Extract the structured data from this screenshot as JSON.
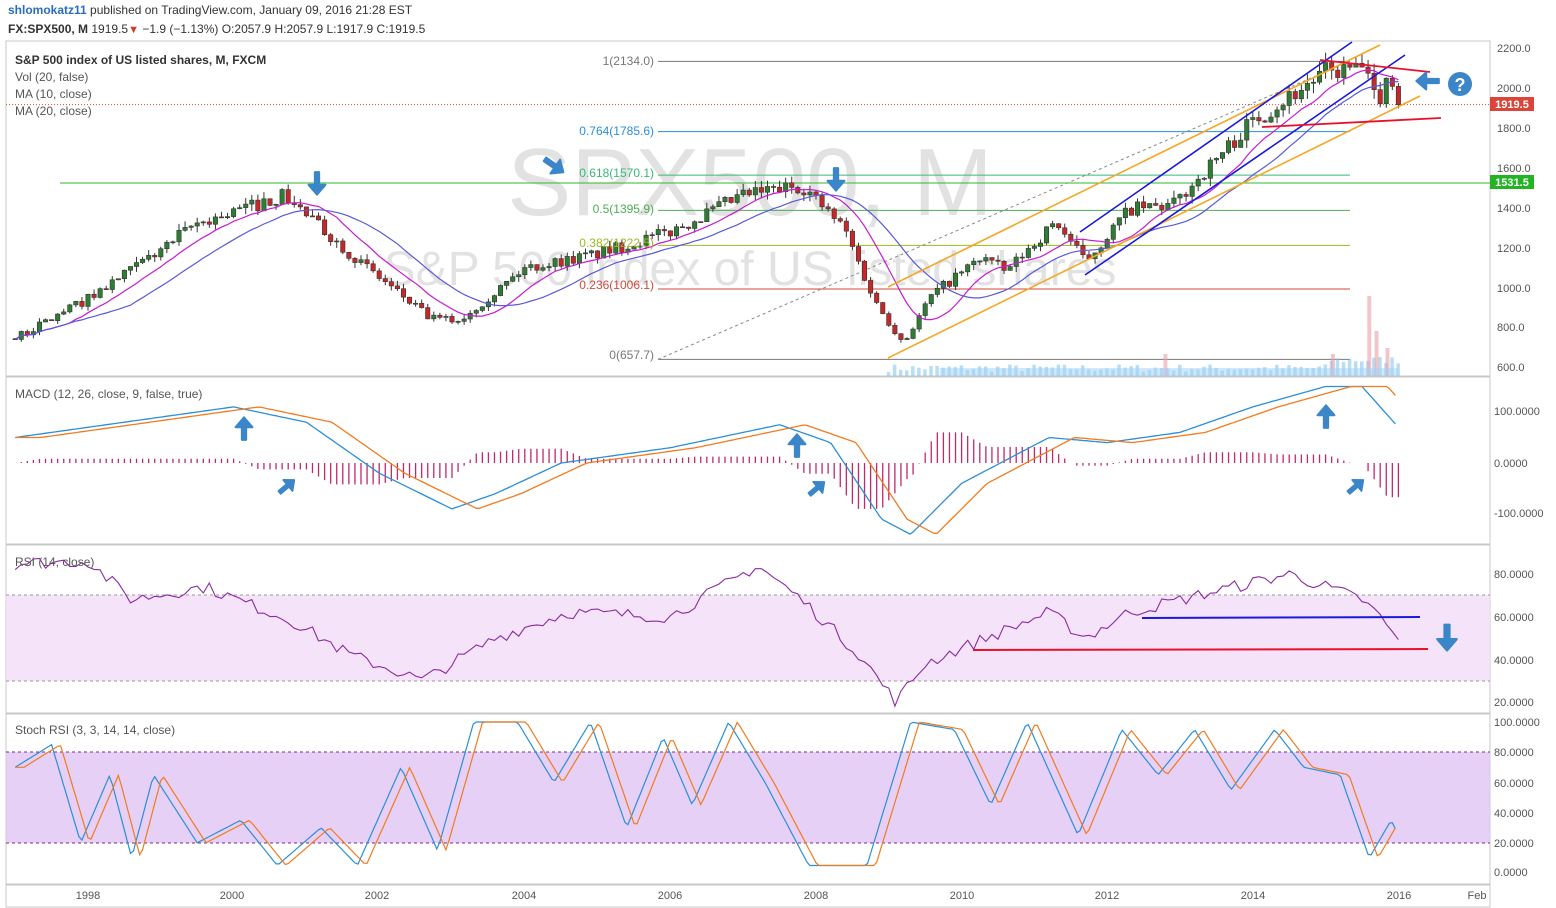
{
  "header": {
    "author": "shlomokatz11",
    "published_text": "published on TradingView.com, January 09, 2016 21:28 EST",
    "symbol": "FX:SPX500, M",
    "last": "1919.5",
    "change": "−1.9 (−1.13%)",
    "open_label": "O:",
    "open": "2057.9",
    "high_label": "H:",
    "high": "2057.9",
    "low_label": "L:",
    "low": "1917.9",
    "close_label": "C:",
    "close": "1919.5"
  },
  "main": {
    "watermark_1": "SPX500, M",
    "watermark_2": "S&P 500 index of US listed shares",
    "legend": [
      "S&P 500 index of US listed shares, M, FXCM",
      "Vol (20, false)",
      "MA (10, close)",
      "MA (20, close)"
    ],
    "y_ticks": [
      "2200.0",
      "2000.0",
      "1800.0",
      "1600.0",
      "1400.0",
      "1200.0",
      "1000.0",
      "800.0",
      "600.0"
    ],
    "price_badge": "1919.5",
    "level_badge": "1531.5",
    "fib_labels": [
      "1(2134.0)",
      "0.764(1785.6)",
      "0.618(1570.1)",
      "0.5(1395.9)",
      "0.382(1222.5)",
      "0.236(1006.1)",
      "0(657.7)"
    ],
    "question_mark": "?"
  },
  "macd": {
    "label": "MACD (12, 26, close, 9, false, true)",
    "y_ticks": [
      "100.0000",
      "0.0000",
      "-100.0000"
    ]
  },
  "rsi": {
    "label": "RSI (14, close)",
    "y_ticks": [
      "80.0000",
      "60.0000",
      "40.0000",
      "20.0000"
    ]
  },
  "stoch": {
    "label": "Stoch RSI (3, 3, 14, 14, close)",
    "y_ticks": [
      "100.0000",
      "80.0000",
      "60.0000",
      "40.0000",
      "20.0000",
      "0.0000"
    ]
  },
  "x_axis": {
    "ticks": [
      "1998",
      "2000",
      "2002",
      "2004",
      "2006",
      "2008",
      "2010",
      "2012",
      "2014",
      "2016",
      "Feb"
    ]
  },
  "colors": {
    "up_candle": "#2e7d32",
    "down_candle": "#c62828",
    "ma10": "#c61bd1",
    "ma20": "#5a5ad8",
    "macd": "#2b8fd6",
    "signal": "#f07b20",
    "hist": "#c0286e",
    "rsi": "#8a2aa0",
    "stoch_k": "#2b8fd6",
    "stoch_d": "#f07b20",
    "channel_blue": "#1a1ad8",
    "channel_orange": "#f5a623",
    "arrow": "#3a86c8",
    "red_line": "#e8112d",
    "green_line": "#2eb82e"
  },
  "chart_data": {
    "type": "candlestick",
    "title": "S&P 500 index of US listed shares, M, FXCM",
    "price_scale": [
      600,
      2200
    ],
    "x_years": [
      1998,
      2000,
      2002,
      2004,
      2006,
      2008,
      2010,
      2012,
      2014,
      2016
    ],
    "price_path": [
      [
        1997.0,
        760
      ],
      [
        1998.0,
        960
      ],
      [
        1998.6,
        1100
      ],
      [
        1999.5,
        1330
      ],
      [
        2000.7,
        1470
      ],
      [
        2001.7,
        1150
      ],
      [
        2002.7,
        860
      ],
      [
        2003.1,
        850
      ],
      [
        2004.0,
        1110
      ],
      [
        2005.0,
        1180
      ],
      [
        2006.0,
        1290
      ],
      [
        2007.0,
        1470
      ],
      [
        2007.8,
        1520
      ],
      [
        2008.4,
        1300
      ],
      [
        2008.8,
        950
      ],
      [
        2009.2,
        740
      ],
      [
        2009.6,
        980
      ],
      [
        2010.3,
        1170
      ],
      [
        2010.6,
        1090
      ],
      [
        2011.3,
        1340
      ],
      [
        2011.7,
        1140
      ],
      [
        2012.3,
        1400
      ],
      [
        2012.9,
        1420
      ],
      [
        2013.5,
        1650
      ],
      [
        2014.0,
        1840
      ],
      [
        2014.5,
        1960
      ],
      [
        2015.0,
        2080
      ],
      [
        2015.5,
        2100
      ],
      [
        2015.7,
        1930
      ],
      [
        2015.9,
        2080
      ],
      [
        2016.0,
        1919.5
      ]
    ],
    "fibonacci": {
      "levels": [
        1,
        0.764,
        0.618,
        0.5,
        0.382,
        0.236,
        0
      ],
      "prices": [
        2134.0,
        1785.6,
        1570.1,
        1395.9,
        1222.5,
        1006.1,
        657.7
      ]
    },
    "horizontal_level": 1531.5,
    "last_close": 1919.5,
    "macd_path": [
      [
        1997.0,
        50
      ],
      [
        1999.0,
        90
      ],
      [
        2000.0,
        110
      ],
      [
        2001.0,
        80
      ],
      [
        2002.0,
        -20
      ],
      [
        2003.0,
        -90
      ],
      [
        2003.6,
        -60
      ],
      [
        2004.5,
        0
      ],
      [
        2006.0,
        30
      ],
      [
        2007.5,
        75
      ],
      [
        2008.2,
        40
      ],
      [
        2008.9,
        -110
      ],
      [
        2009.3,
        -140
      ],
      [
        2010.0,
        -40
      ],
      [
        2011.2,
        50
      ],
      [
        2012.0,
        40
      ],
      [
        2013.0,
        60
      ],
      [
        2014.0,
        110
      ],
      [
        2015.0,
        150
      ],
      [
        2015.5,
        150
      ],
      [
        2016.0,
        70
      ]
    ],
    "rsi_path": [
      [
        1997.0,
        85
      ],
      [
        1998.0,
        86
      ],
      [
        1998.6,
        68
      ],
      [
        1999.6,
        74
      ],
      [
        2000.8,
        58
      ],
      [
        2001.6,
        42
      ],
      [
        2002.6,
        30
      ],
      [
        2003.6,
        50
      ],
      [
        2004.6,
        62
      ],
      [
        2006.0,
        60
      ],
      [
        2007.2,
        84
      ],
      [
        2007.8,
        68
      ],
      [
        2008.6,
        42
      ],
      [
        2009.1,
        20
      ],
      [
        2009.5,
        38
      ],
      [
        2010.2,
        48
      ],
      [
        2011.2,
        62
      ],
      [
        2011.7,
        50
      ],
      [
        2012.3,
        62
      ],
      [
        2013.5,
        72
      ],
      [
        2014.5,
        80
      ],
      [
        2015.5,
        68
      ],
      [
        2015.8,
        58
      ],
      [
        2016.0,
        48
      ]
    ],
    "stoch_path": [
      [
        1997.0,
        70
      ],
      [
        1997.5,
        85
      ],
      [
        1997.9,
        20
      ],
      [
        1998.3,
        65
      ],
      [
        1998.6,
        10
      ],
      [
        1998.9,
        65
      ],
      [
        1999.5,
        20
      ],
      [
        2000.1,
        35
      ],
      [
        2000.6,
        5
      ],
      [
        2001.2,
        30
      ],
      [
        2001.7,
        5
      ],
      [
        2002.3,
        70
      ],
      [
        2002.8,
        15
      ],
      [
        2003.3,
        100
      ],
      [
        2003.9,
        100
      ],
      [
        2004.4,
        60
      ],
      [
        2004.9,
        100
      ],
      [
        2005.4,
        30
      ],
      [
        2005.9,
        90
      ],
      [
        2006.3,
        45
      ],
      [
        2006.8,
        100
      ],
      [
        2007.3,
        60
      ],
      [
        2007.9,
        5
      ],
      [
        2008.7,
        5
      ],
      [
        2009.3,
        100
      ],
      [
        2009.9,
        95
      ],
      [
        2010.4,
        45
      ],
      [
        2010.9,
        100
      ],
      [
        2011.6,
        25
      ],
      [
        2012.2,
        95
      ],
      [
        2012.7,
        65
      ],
      [
        2013.2,
        95
      ],
      [
        2013.7,
        55
      ],
      [
        2014.3,
        95
      ],
      [
        2014.7,
        70
      ],
      [
        2015.2,
        65
      ],
      [
        2015.6,
        10
      ],
      [
        2015.9,
        35
      ],
      [
        2016.0,
        25
      ]
    ]
  }
}
